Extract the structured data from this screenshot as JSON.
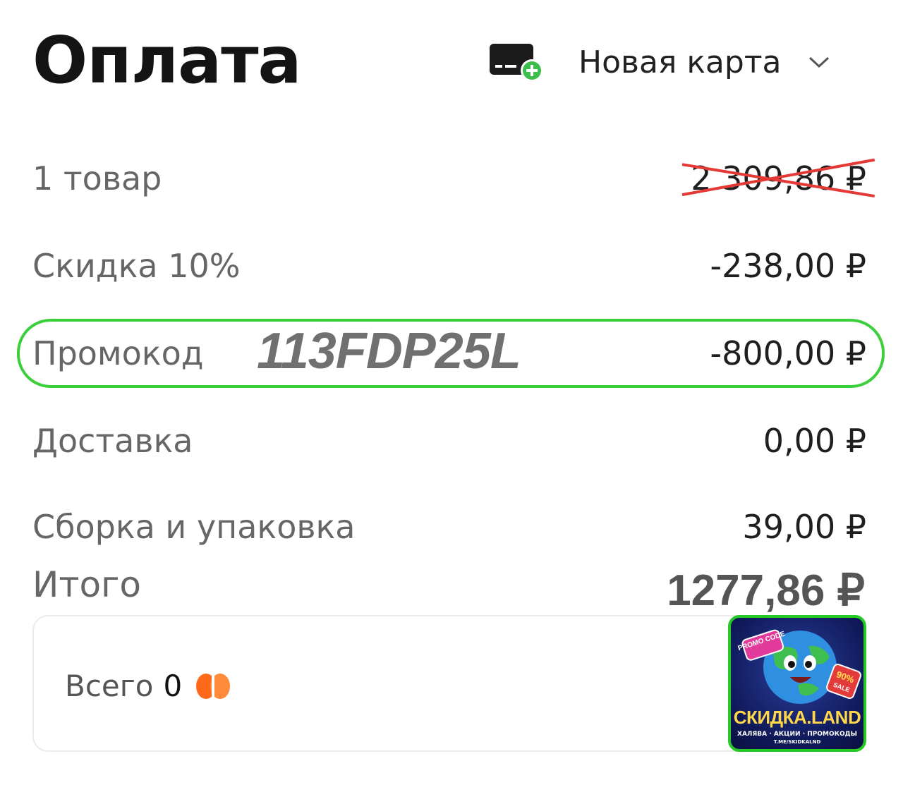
{
  "header": {
    "title": "Оплата",
    "payment_method": "Новая карта"
  },
  "summary": {
    "rows": [
      {
        "label": "1 товар",
        "value": "2 309,86 ₽",
        "struck": true
      },
      {
        "label": "Скидка 10%",
        "value": "-238,00 ₽"
      },
      {
        "label": "Промокод",
        "value": "-800,00 ₽",
        "code": "113FDP25L"
      },
      {
        "label": "Доставка",
        "value": "0,00 ₽"
      },
      {
        "label": "Сборка и упаковка",
        "value": "39,00 ₽"
      }
    ],
    "total_label": "Итого",
    "total_value": "1277,86 ₽"
  },
  "bonus": {
    "label": "Всего",
    "count": "0"
  },
  "watermark": {
    "badge": "PROMO CODE",
    "sale": "90%",
    "sale_word": "SALE",
    "title": "СКИДКА.LAND",
    "tagline": "ХАЛЯВА · АКЦИИ · ПРОМОКОДЫ",
    "link": "T.ME/SKIDKALND"
  },
  "colors": {
    "highlight_green": "#3ccf3c",
    "strike_red": "#e53935",
    "coin_orange": "#ff6a1a"
  }
}
